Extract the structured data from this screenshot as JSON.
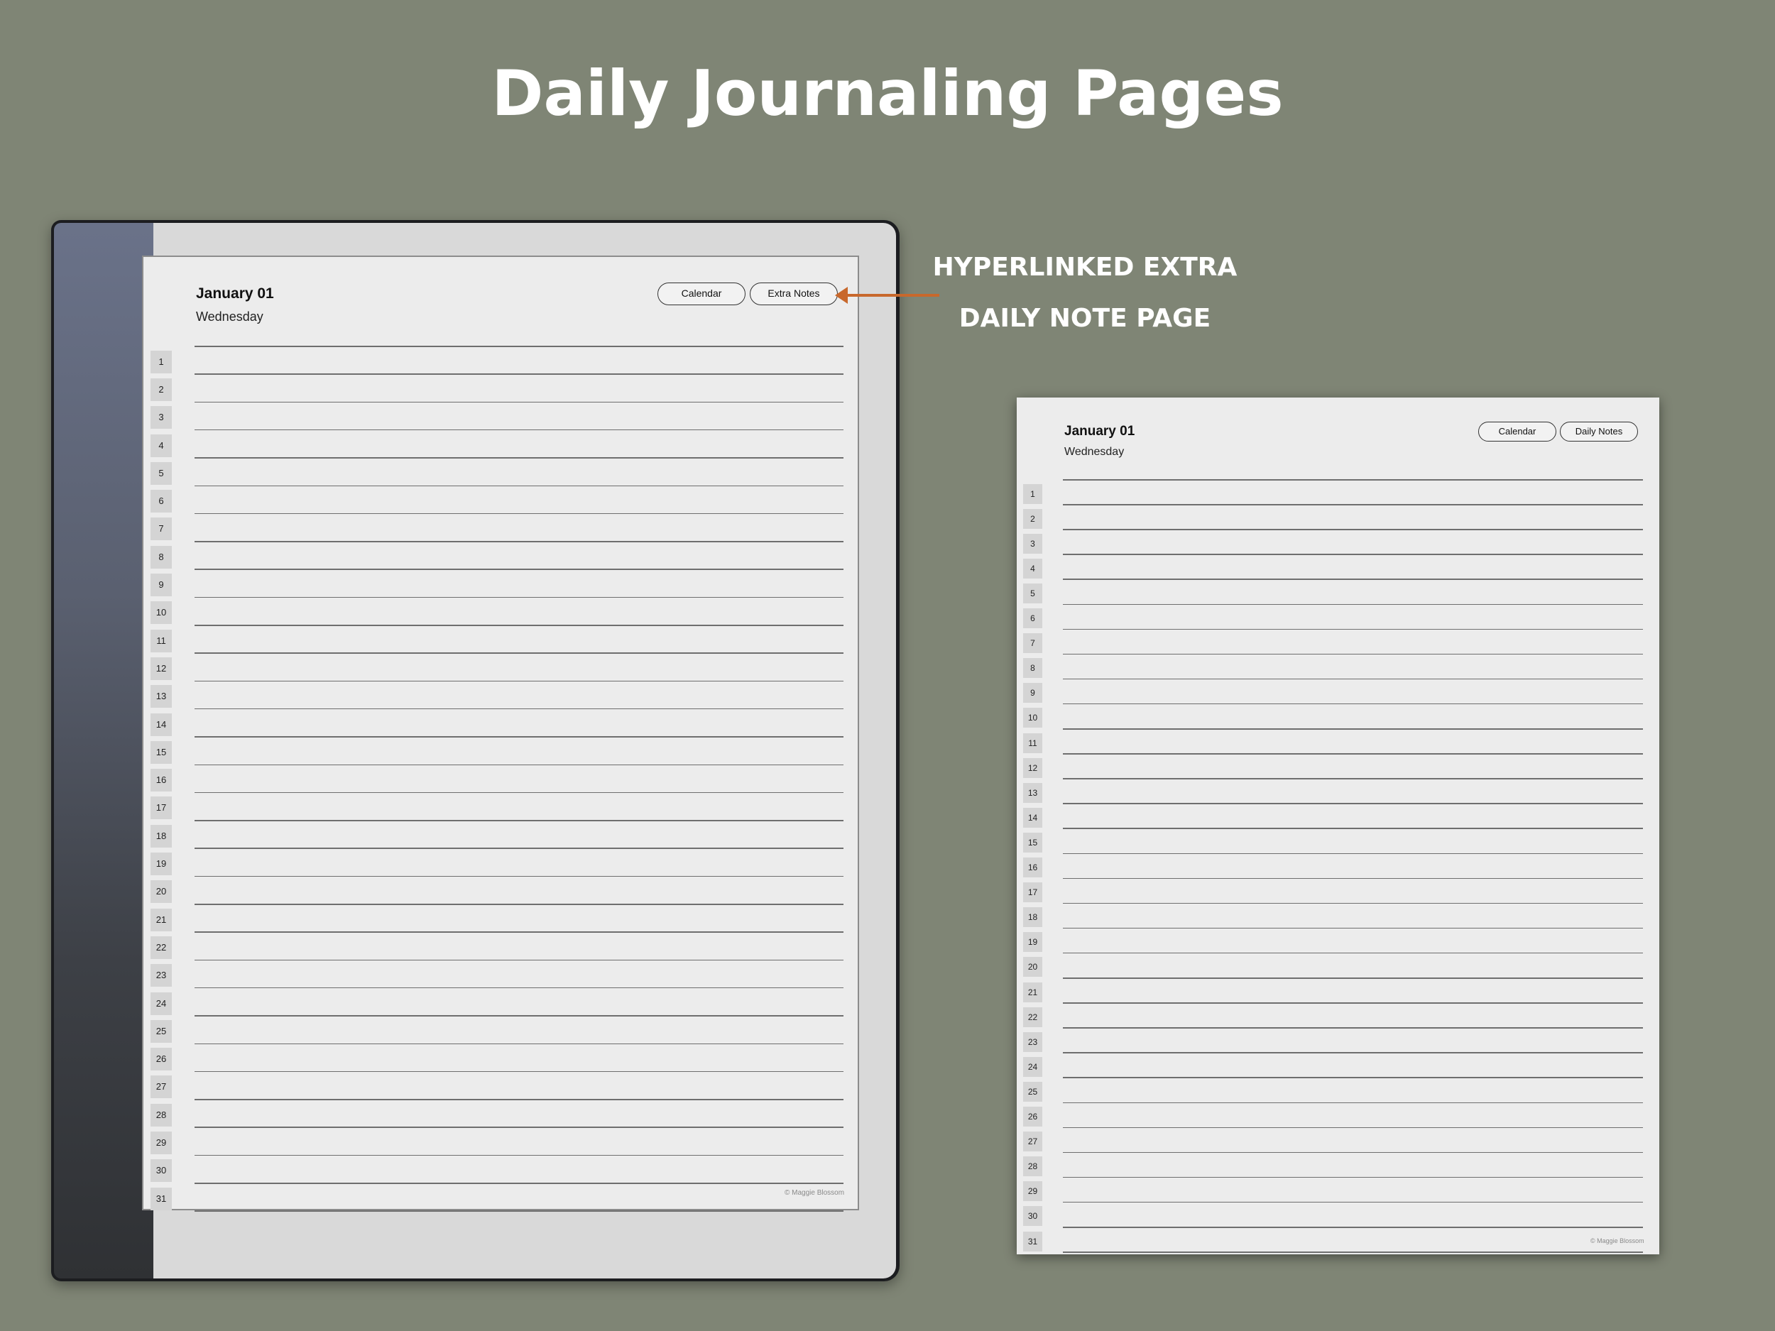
{
  "title": "Daily Journaling Pages",
  "annotation": {
    "line1": "HYPERLINKED EXTRA",
    "line2": "DAILY NOTE PAGE"
  },
  "accent_color": "#c8682c",
  "device_page": {
    "date": "January 01",
    "weekday": "Wednesday",
    "buttons": [
      "Calendar",
      "Extra Notes"
    ],
    "copyright": "© Maggie Blossom"
  },
  "extra_page": {
    "date": "January 01",
    "weekday": "Wednesday",
    "buttons": [
      "Calendar",
      "Daily Notes"
    ],
    "copyright": "© Maggie Blossom"
  },
  "line_numbers": [
    "1",
    "2",
    "3",
    "4",
    "5",
    "6",
    "7",
    "8",
    "9",
    "10",
    "11",
    "12",
    "13",
    "14",
    "15",
    "16",
    "17",
    "18",
    "19",
    "20",
    "21",
    "22",
    "23",
    "24",
    "25",
    "26",
    "27",
    "28",
    "29",
    "30",
    "31"
  ]
}
